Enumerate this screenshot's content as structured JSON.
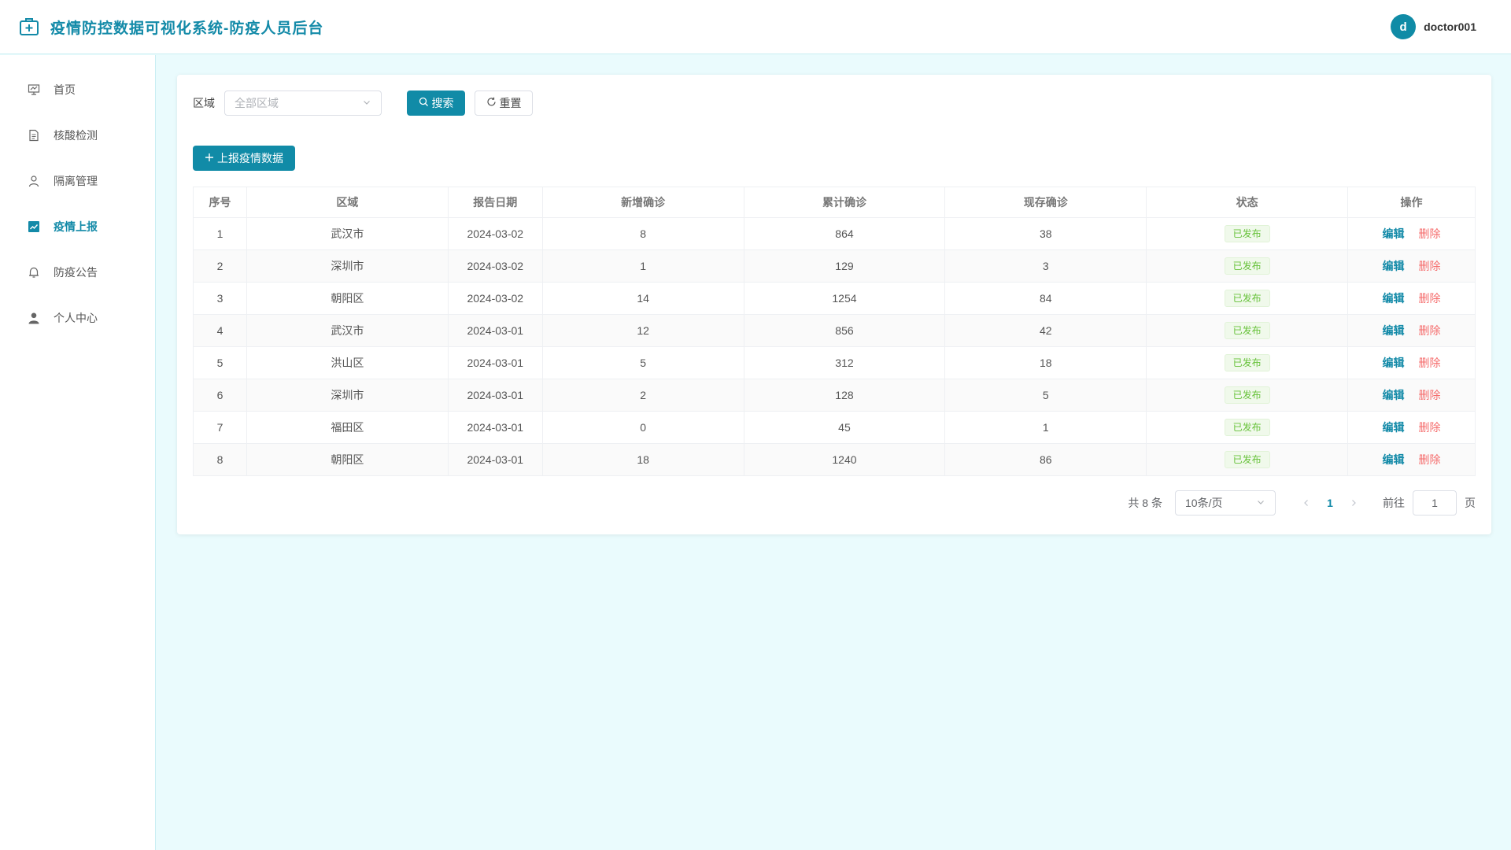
{
  "header": {
    "title": "疫情防控数据可视化系统-防疫人员后台",
    "avatar_letter": "d",
    "username": "doctor001"
  },
  "sidebar": {
    "items": [
      {
        "label": "首页",
        "icon": "presentation-icon",
        "active": false
      },
      {
        "label": "核酸检测",
        "icon": "document-icon",
        "active": false
      },
      {
        "label": "隔离管理",
        "icon": "user-icon",
        "active": false
      },
      {
        "label": "疫情上报",
        "icon": "chart-icon",
        "active": true
      },
      {
        "label": "防疫公告",
        "icon": "bell-icon",
        "active": false
      },
      {
        "label": "个人中心",
        "icon": "user-filled-icon",
        "active": false
      }
    ]
  },
  "filter": {
    "label": "区域",
    "select_placeholder": "全部区域",
    "search_label": "搜索",
    "reset_label": "重置"
  },
  "report_button": "上报疫情数据",
  "table": {
    "columns": [
      "序号",
      "区域",
      "报告日期",
      "新增确诊",
      "累计确诊",
      "现存确诊",
      "状态",
      "操作"
    ],
    "rows": [
      {
        "index": "1",
        "region": "武汉市",
        "date": "2024-03-02",
        "new_cases": "8",
        "total_cases": "864",
        "current_cases": "38",
        "status": "已发布"
      },
      {
        "index": "2",
        "region": "深圳市",
        "date": "2024-03-02",
        "new_cases": "1",
        "total_cases": "129",
        "current_cases": "3",
        "status": "已发布"
      },
      {
        "index": "3",
        "region": "朝阳区",
        "date": "2024-03-02",
        "new_cases": "14",
        "total_cases": "1254",
        "current_cases": "84",
        "status": "已发布"
      },
      {
        "index": "4",
        "region": "武汉市",
        "date": "2024-03-01",
        "new_cases": "12",
        "total_cases": "856",
        "current_cases": "42",
        "status": "已发布"
      },
      {
        "index": "5",
        "region": "洪山区",
        "date": "2024-03-01",
        "new_cases": "5",
        "total_cases": "312",
        "current_cases": "18",
        "status": "已发布"
      },
      {
        "index": "6",
        "region": "深圳市",
        "date": "2024-03-01",
        "new_cases": "2",
        "total_cases": "128",
        "current_cases": "5",
        "status": "已发布"
      },
      {
        "index": "7",
        "region": "福田区",
        "date": "2024-03-01",
        "new_cases": "0",
        "total_cases": "45",
        "current_cases": "1",
        "status": "已发布"
      },
      {
        "index": "8",
        "region": "朝阳区",
        "date": "2024-03-01",
        "new_cases": "18",
        "total_cases": "1240",
        "current_cases": "86",
        "status": "已发布"
      }
    ],
    "edit_label": "编辑",
    "delete_label": "删除"
  },
  "pagination": {
    "total_text": "共 8 条",
    "page_size": "10条/页",
    "current_page": "1",
    "goto_label": "前往",
    "goto_value": "1",
    "page_unit": "页"
  },
  "colors": {
    "primary": "#118ba7",
    "danger": "#f56c6c",
    "success": "#67c23a",
    "background": "#eafbfd"
  }
}
